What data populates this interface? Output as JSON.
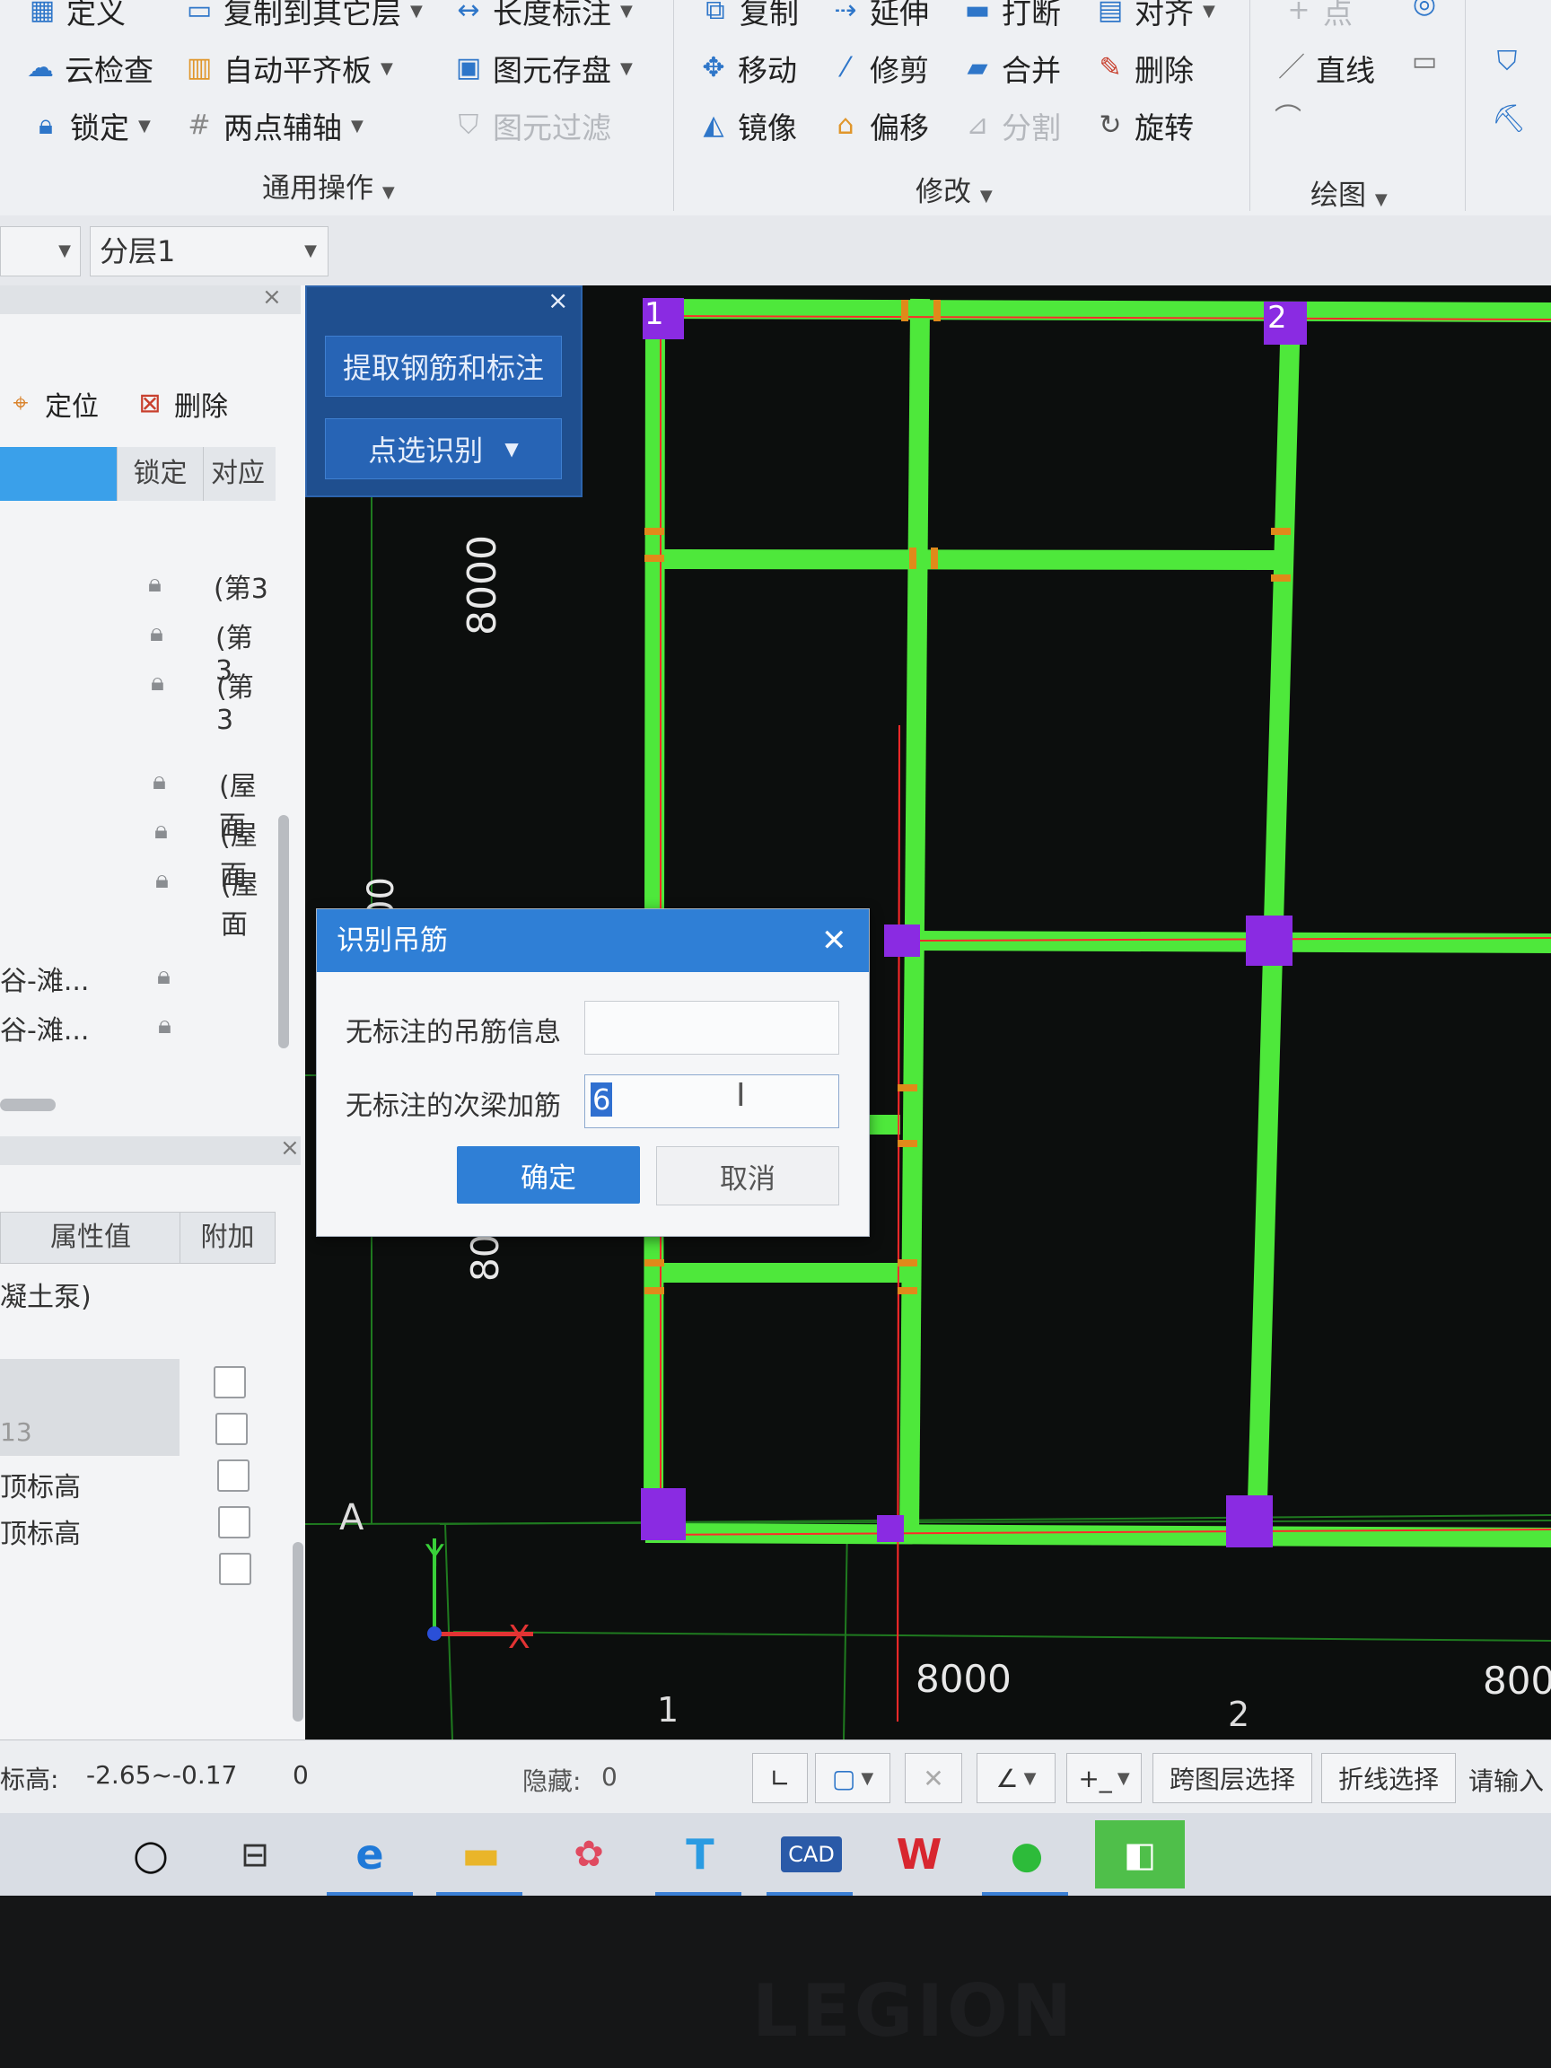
{
  "ribbon": {
    "row1": [
      "定义",
      "复制到其它层",
      "长度标注",
      "复制",
      "延伸",
      "打断",
      "对齐",
      "点"
    ],
    "general": {
      "cloud_check": "云检查",
      "auto_align_slab": "自动平齐板",
      "element_save": "图元存盘",
      "lock": "锁定",
      "two_point_axis": "两点辅轴",
      "element_filter": "图元过滤",
      "group_label": "通用操作"
    },
    "modify": {
      "move": "移动",
      "trim": "修剪",
      "merge": "合并",
      "delete": "删除",
      "mirror": "镜像",
      "offset": "偏移",
      "split": "分割",
      "rotate": "旋转",
      "group_label": "修改"
    },
    "draw": {
      "line": "直线",
      "group_label": "绘图"
    }
  },
  "toolbar2": {
    "layer_combo": "分层1"
  },
  "left_panel": {
    "locate": "定位",
    "delete": "删除",
    "col_lock": "锁定",
    "col_corr": "对应",
    "rows": [
      {
        "label": "",
        "corr": "(第3"
      },
      {
        "label": "",
        "corr": "(第3"
      },
      {
        "label": "",
        "corr": "(第3"
      },
      {
        "label": "",
        "corr": "(屋面"
      },
      {
        "label": "",
        "corr": "(屋面"
      },
      {
        "label": "",
        "corr": "(屋面"
      },
      {
        "label": "谷-滩...",
        "corr": ""
      },
      {
        "label": "谷-滩...",
        "corr": ""
      }
    ],
    "props": {
      "col_value": "属性值",
      "col_extra": "附加",
      "rows": [
        "凝土泵)",
        "",
        "",
        "13",
        "顶标高",
        "顶标高",
        ""
      ]
    }
  },
  "float_panel": {
    "extract_btn": "提取钢筋和标注",
    "select_btn": "点选识别"
  },
  "canvas": {
    "axis_labels": [
      "1",
      "2",
      "1",
      "2",
      "A"
    ],
    "dims": [
      "8000",
      "8000",
      "800",
      "80",
      "00"
    ],
    "ucs_y": "Y",
    "ucs_x": "X",
    "colors": {
      "beam": "#4ee83b",
      "column": "#8a2be2",
      "red_line": "#ff2a2a",
      "axis_line": "#1f7a1f"
    }
  },
  "dialog": {
    "title": "识别吊筋",
    "label1": "无标注的吊筋信息",
    "value1": "",
    "label2": "无标注的次梁加筋",
    "value2": "6",
    "ok": "确定",
    "cancel": "取消"
  },
  "status": {
    "elevation_label": "标高:",
    "elevation_value": "-2.65~-0.17",
    "count": "0",
    "hidden_label": "隐藏:",
    "hidden_value": "0",
    "cross_layer": "跨图层选择",
    "polyline": "折线选择",
    "prompt": "请输入"
  },
  "taskbar": {
    "apps": [
      "circle-icon",
      "task-view-icon",
      "edge-icon",
      "explorer-icon",
      "baidu-icon",
      "t-icon",
      "cad-icon",
      "wps-icon",
      "wechat-icon",
      "glodon-icon"
    ],
    "cad_text": "CAD"
  },
  "bezel": {
    "brand": "LEGION"
  }
}
